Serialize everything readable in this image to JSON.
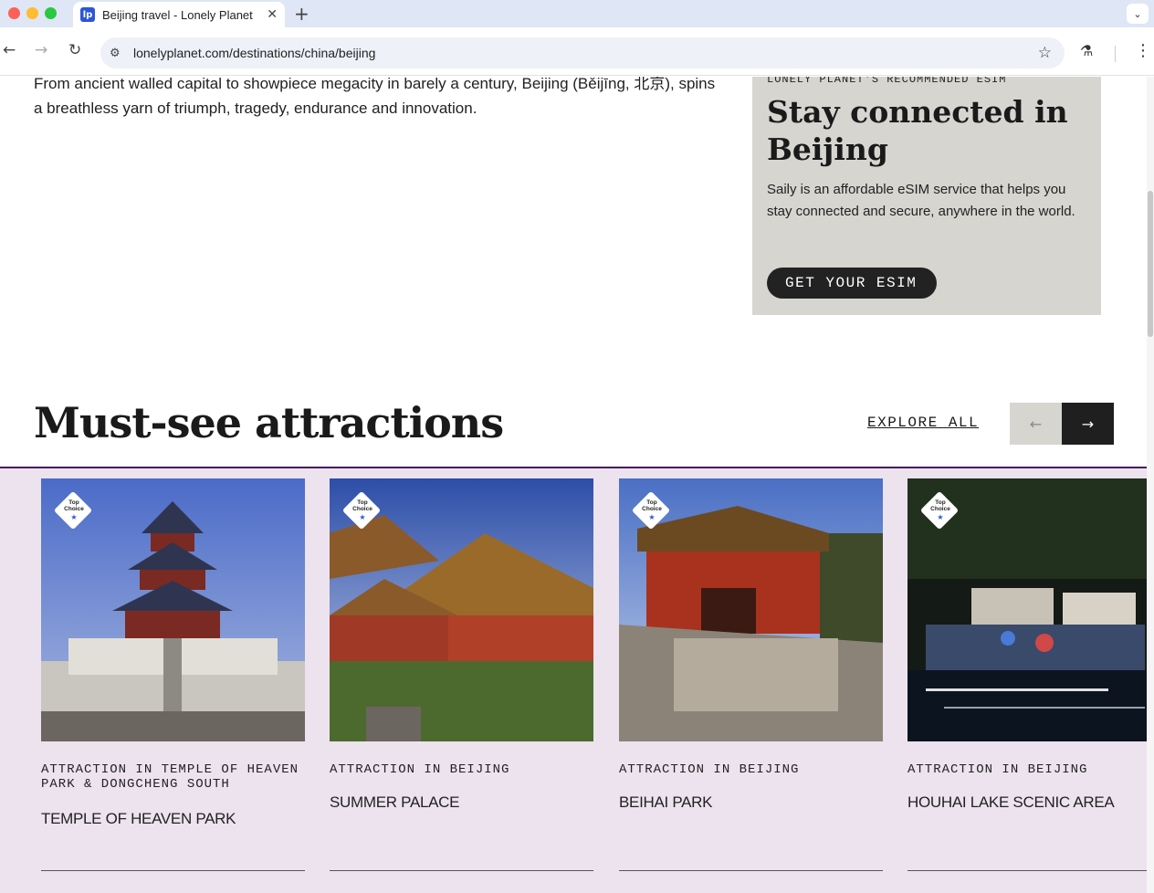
{
  "browser": {
    "tab_title": "Beijing travel - Lonely Planet",
    "favicon": "lp",
    "url": "lonelyplanet.com/destinations/china/beijing"
  },
  "intro": {
    "text": "From ancient walled capital to showpiece megacity in barely a century, Beijing (Běijīng, 北京), spins a breathless yarn of triumph, tragedy, endurance and innovation."
  },
  "esim": {
    "eyebrow": "LONELY PLANET'S RECOMMENDED ESIM",
    "title": "Stay connected in Beijing",
    "description": "Saily is an affordable eSIM service that helps you stay connected and secure, anywhere in the world.",
    "button": "GET YOUR ESIM"
  },
  "attractions": {
    "title": "Must-see attractions",
    "explore_all": "EXPLORE ALL",
    "badge": "Top Choice",
    "cards": [
      {
        "category": "ATTRACTION IN TEMPLE OF HEAVEN PARK & DONGCHENG SOUTH",
        "name": "TEMPLE OF HEAVEN PARK"
      },
      {
        "category": "ATTRACTION IN BEIJING",
        "name": "SUMMER PALACE"
      },
      {
        "category": "ATTRACTION IN BEIJING",
        "name": "BEIHAI PARK"
      },
      {
        "category": "ATTRACTION IN BEIJING",
        "name": "HOUHAI LAKE SCENIC AREA"
      }
    ]
  },
  "colors": {
    "esim_bg": "#d6d5d0",
    "band_bg": "#ece3ee",
    "dark": "#1f1f1f"
  }
}
